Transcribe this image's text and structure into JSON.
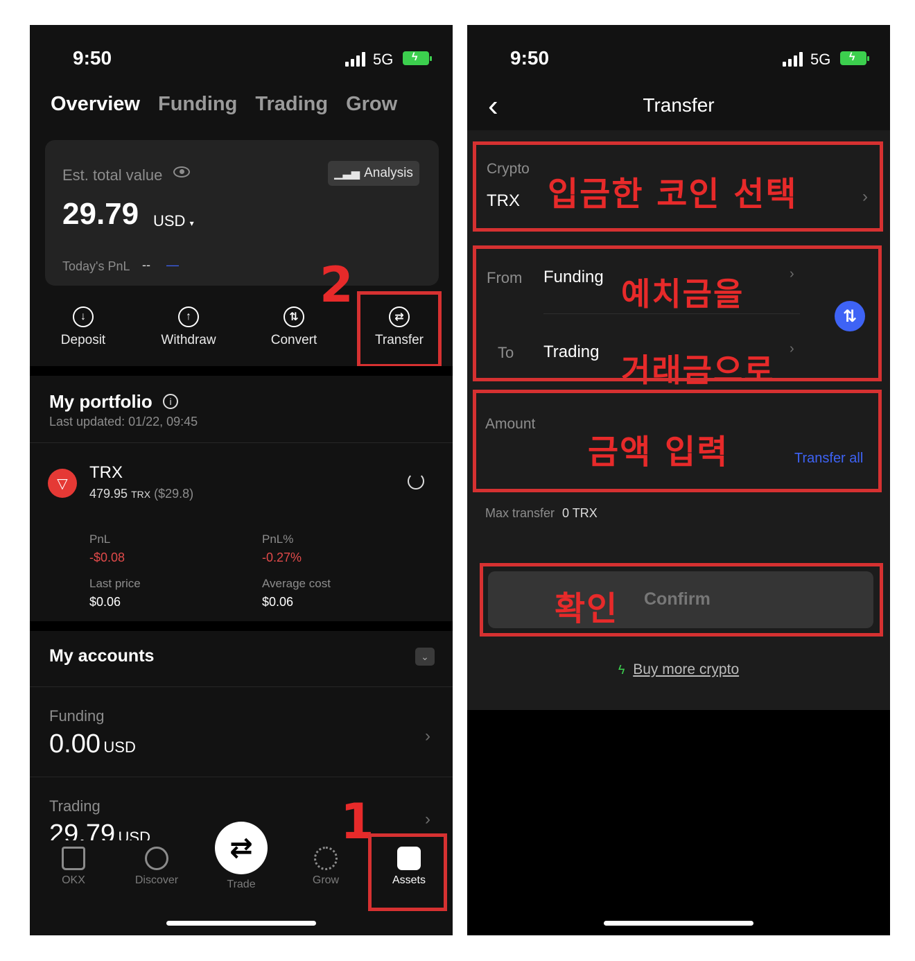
{
  "left": {
    "status": {
      "time": "9:50",
      "network": "5G"
    },
    "tabs": [
      {
        "label": "Overview",
        "active": true
      },
      {
        "label": "Funding",
        "active": false
      },
      {
        "label": "Trading",
        "active": false
      },
      {
        "label": "Grow",
        "active": false
      }
    ],
    "summary": {
      "est_label": "Est. total value",
      "analysis_label": "Analysis",
      "value": "29.79",
      "currency": "USD",
      "pnl_label": "Today's PnL",
      "pnl_value": "--",
      "pnl_extra": "—"
    },
    "actions": [
      {
        "label": "Deposit",
        "icon": "download-icon",
        "glyph": "↓"
      },
      {
        "label": "Withdraw",
        "icon": "upload-icon",
        "glyph": "↑"
      },
      {
        "label": "Convert",
        "icon": "convert-icon",
        "glyph": "⇅"
      },
      {
        "label": "Transfer",
        "icon": "transfer-icon",
        "glyph": "⇄"
      }
    ],
    "portfolio": {
      "title": "My portfolio",
      "updated": "Last updated: 01/22, 09:45",
      "asset": {
        "symbol": "TRX",
        "amount": "479.95",
        "unit": "TRX",
        "fiat": "($29.8)",
        "pnl_label": "PnL",
        "pnl": "-$0.08",
        "pnl_pct_label": "PnL%",
        "pnl_pct": "-0.27%",
        "last_price_label": "Last price",
        "last_price": "$0.06",
        "avg_cost_label": "Average cost",
        "avg_cost": "$0.06"
      }
    },
    "accounts": {
      "title": "My accounts",
      "funding_label": "Funding",
      "funding_value": "0.00",
      "funding_unit": "USD",
      "trading_label": "Trading",
      "trading_value": "29.79",
      "trading_unit": "USD"
    },
    "nav": [
      {
        "label": "OKX",
        "icon": "home-icon"
      },
      {
        "label": "Discover",
        "icon": "discover-icon"
      },
      {
        "label": "Trade",
        "icon": "trade-icon"
      },
      {
        "label": "Grow",
        "icon": "grow-icon"
      },
      {
        "label": "Assets",
        "icon": "wallet-icon"
      }
    ],
    "annotations": {
      "step1": "1",
      "step2": "2"
    }
  },
  "right": {
    "status": {
      "time": "9:50",
      "network": "5G"
    },
    "header": {
      "back": "‹",
      "title": "Transfer"
    },
    "crypto": {
      "label": "Crypto",
      "value": "TRX",
      "annotation": "입금한 코인 선택"
    },
    "route": {
      "from_label": "From",
      "from_value": "Funding",
      "to_label": "To",
      "to_value": "Trading",
      "annotation_from": "예치금을",
      "annotation_to": "거래금으로"
    },
    "amount": {
      "label": "Amount",
      "transfer_all": "Transfer all",
      "annotation": "금액 입력"
    },
    "max_transfer": {
      "label": "Max transfer",
      "value": "0 TRX"
    },
    "confirm": {
      "label": "Confirm",
      "annotation": "확인"
    },
    "buy_more": "Buy more crypto"
  },
  "colors": {
    "accent_red": "#e72a2a",
    "loss": "#e14a4a",
    "link": "#3e63f5",
    "battery": "#3ccf4e"
  }
}
